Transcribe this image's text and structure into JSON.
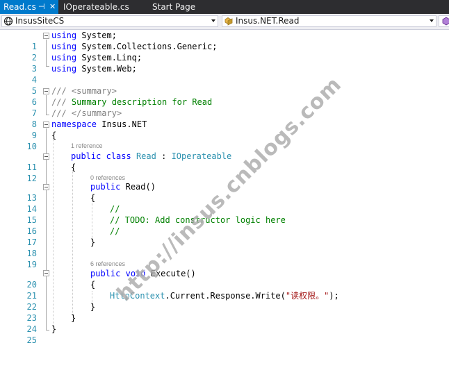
{
  "tabs": [
    {
      "label": "Read.cs",
      "pin_glyph": "⊣",
      "close_glyph": "✕"
    },
    {
      "label": "IOperateable.cs"
    },
    {
      "label": "Start Page"
    }
  ],
  "navbar": {
    "project": "InsusSiteCS",
    "type": "Insus.NET.Read"
  },
  "editor": {
    "lines": [
      {
        "n": "1"
      },
      {
        "n": "2"
      },
      {
        "n": "3"
      },
      {
        "n": "4"
      },
      {
        "n": "5"
      },
      {
        "n": "6"
      },
      {
        "n": "7"
      },
      {
        "n": "8"
      },
      {
        "n": "9"
      },
      {
        "n": "10"
      },
      {
        "n": "11"
      },
      {
        "n": "12"
      },
      {
        "n": "13"
      },
      {
        "n": "14"
      },
      {
        "n": "15"
      },
      {
        "n": "16"
      },
      {
        "n": "17"
      },
      {
        "n": "18"
      },
      {
        "n": "19"
      },
      {
        "n": "20"
      },
      {
        "n": "21"
      },
      {
        "n": "22"
      },
      {
        "n": "23"
      },
      {
        "n": "24"
      },
      {
        "n": "25"
      }
    ],
    "codelens": {
      "class_refs": "1 reference",
      "ctor_refs": "0 references",
      "method_refs": "6 references"
    },
    "tokens": {
      "using": "using",
      "system": "System;",
      "system_collections": "System.Collections.Generic;",
      "system_linq": "System.Linq;",
      "system_web": "System.Web;",
      "doc_prefix": "///",
      "summary_open": "<summary>",
      "summary_text": "Summary description for Read",
      "summary_close": "</summary>",
      "namespace_kw": "namespace",
      "namespace_name": "Insus.NET",
      "open_brace": "{",
      "close_brace": "}",
      "public_kw": "public",
      "class_kw": "class",
      "class_name": "Read",
      "colon": ":",
      "interface_name": "IOperateable",
      "ctor": "Read()",
      "comment_slashes": "//",
      "todo_comment": "// TODO: Add constructor logic here",
      "void_kw": "void",
      "method": "Execute()",
      "httpcontext": "HttpContext",
      "call_chain": ".Current.Response.Write(",
      "string_literal": "\"读权限。\"",
      "call_end": ");"
    }
  },
  "watermark": "http://insus.cnblogs.com",
  "colors": {
    "tab_strip": "#2d2d30",
    "active_tab": "#007acc",
    "keyword": "#0000ff",
    "type": "#2b91af",
    "comment": "#008000",
    "string": "#a31515",
    "line_number": "#2b91af"
  }
}
